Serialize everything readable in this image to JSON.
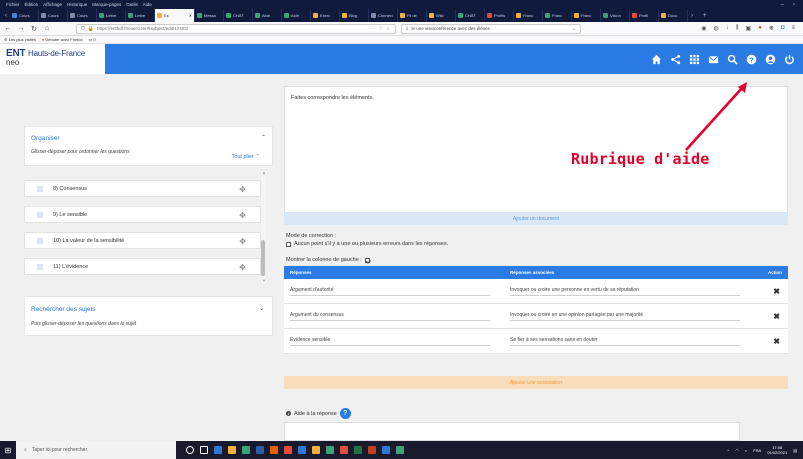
{
  "browser": {
    "menu": [
      "Fichier",
      "Édition",
      "Affichage",
      "Historique",
      "Marque-pages",
      "Outils",
      "Aide"
    ],
    "window_controls": [
      "–",
      "▫"
    ],
    "tabs": [
      {
        "label": "Cours",
        "color": "#4a7fd4"
      },
      {
        "label": "Cours",
        "color": "#7d8da6"
      },
      {
        "label": "Cours",
        "color": "#7d8da6"
      },
      {
        "label": "Lettre",
        "color": "#3f9a7b"
      },
      {
        "label": "Lettre",
        "color": "#3f9a7b"
      },
      {
        "label": "Ex",
        "color": "#f2b13a",
        "active": true
      },
      {
        "label": "Messa",
        "color": "#3aa676"
      },
      {
        "label": "CHAT",
        "color": "#3aa676"
      },
      {
        "label": "Aide",
        "color": "#3aa676"
      },
      {
        "label": "Aide",
        "color": "#3aa676"
      },
      {
        "label": "Exerc",
        "color": "#f2b13a"
      },
      {
        "label": "Blog",
        "color": "#f2b13a"
      },
      {
        "label": "Connexi",
        "color": "#7d8da6"
      },
      {
        "label": "Fil de",
        "color": "#f2b13a"
      },
      {
        "label": "Wiki",
        "color": "#f2b13a"
      },
      {
        "label": "CHAT",
        "color": "#3aa676"
      },
      {
        "label": "Profils",
        "color": "#e84b3c"
      },
      {
        "label": "Franc",
        "color": "#f2b13a"
      },
      {
        "label": "Franc",
        "color": "#3aa676"
      },
      {
        "label": "Franc",
        "color": "#f2b13a"
      },
      {
        "label": "Vision",
        "color": "#3f9a7b"
      },
      {
        "label": "Profil",
        "color": "#e84b3c"
      },
      {
        "label": "Docu",
        "color": "#f2b13a"
      }
    ],
    "url": "https://enthdf.fr/exercizer#/subject/edit/17403/",
    "search_text": "le une visioconférence avec des élèves",
    "bookmarks": [
      "Les plus visités",
      "Débuter avec Firefox",
      "0"
    ]
  },
  "app": {
    "logo_main": "ENT",
    "logo_region": "Hauts-de-France",
    "logo_sub": "neo",
    "header_icons": [
      "home-icon",
      "share-icon",
      "apps-icon",
      "messages-icon",
      "search-icon",
      "help-icon",
      "user-icon",
      "power-icon"
    ]
  },
  "organiser": {
    "title": "Organiser",
    "subtitle": "Glisser-déposer pour ordonner les questions",
    "toggle_all": "Tout plier"
  },
  "questions": [
    "8) Consensus",
    "9) Le sensible",
    "10) La valeur de la sensibilité",
    "11) L'évidence"
  ],
  "recherche": {
    "title": "Rechercher des sujets",
    "subtitle": "Puis glisser-déposer les questions dans le sujet"
  },
  "editor": {
    "prompt": "Faites correspondre les éléments.",
    "add_document": "Ajouter un document",
    "mode_label": "Mode de correction :",
    "mode_option": "Aucun point s'il y a une ou plusieurs erreurs dans les réponses.",
    "show_left_column": "Montrer la colonne de gauche :",
    "table_headers": [
      "Réponses",
      "Réponses associées",
      "Action"
    ],
    "rows": [
      {
        "answer": "Argument d'autorité",
        "associated": "Invoquer ou croire une personne en vertu de  sa réputation"
      },
      {
        "answer": "Argument du consensus",
        "associated": "Invoquer ou croire en une opinion partagée par une majorité"
      },
      {
        "answer": "Evidence sensible",
        "associated": "Se fier à ses sensations sans en douter"
      }
    ],
    "add_association": "Ajouter une association",
    "help_answer": "Aide à la réponse"
  },
  "annotation": {
    "text": "Rubrique d'aide",
    "color": "#e4002b"
  },
  "taskbar": {
    "search_placeholder": "Taper ici pour rechercher",
    "lang": "FRA",
    "time": "17:08",
    "date": "01/02/2021"
  }
}
